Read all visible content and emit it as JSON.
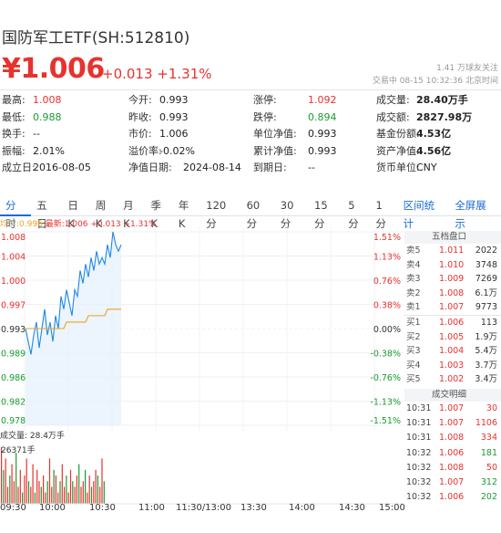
{
  "header": {
    "title": "国防军工ETF(SH:512810)",
    "price": "¥1.006",
    "change": "+0.013 +1.31%",
    "follow": "1.41 万球友关注",
    "status": "交易中 08-15 10:32:36 北京时间"
  },
  "stats": [
    [
      {
        "k": "最高:",
        "v": "1.008",
        "c": "up"
      },
      {
        "k": "今开:",
        "v": "0.993"
      },
      {
        "k": "涨停:",
        "v": "1.092",
        "c": "up"
      },
      {
        "k": "成交量:",
        "v": "28.40万手",
        "c": "b"
      }
    ],
    [
      {
        "k": "最低:",
        "v": "0.988",
        "c": "dn"
      },
      {
        "k": "昨收:",
        "v": "0.993"
      },
      {
        "k": "跌停:",
        "v": "0.894",
        "c": "dn"
      },
      {
        "k": "成交额:",
        "v": "2827.98万",
        "c": "b"
      }
    ],
    [
      {
        "k": "换手:",
        "v": "--"
      },
      {
        "k": "市价:",
        "v": "1.006"
      },
      {
        "k": "单位净值:",
        "v": "0.993"
      },
      {
        "k": "基金份额:",
        "v": "4.53亿",
        "c": "b"
      }
    ],
    [
      {
        "k": "振幅:",
        "v": "2.01%"
      },
      {
        "k": "溢价率:",
        "v": "-0.02%"
      },
      {
        "k": "累计净值:",
        "v": "0.993"
      },
      {
        "k": "资产净值:",
        "v": "4.56亿",
        "c": "b"
      }
    ],
    [
      {
        "k": "成立日:",
        "v": "2016-08-05"
      },
      {
        "k": "净值日期:",
        "v": "2024-08-14"
      },
      {
        "k": "到期日:",
        "v": "--"
      },
      {
        "k": "货币单位:",
        "v": "CNY"
      }
    ]
  ],
  "tabs": [
    "分时",
    "五日",
    "日K",
    "周K",
    "月K",
    "季K",
    "年K",
    "120分",
    "60分",
    "30分",
    "15分",
    "5分",
    "1分"
  ],
  "tabs_right": [
    "区间统计",
    "全屏展示"
  ],
  "legend": {
    "avg": "均价:0.996",
    "cur": "最新:1.006 +0.013 +1.31%"
  },
  "chart_data": {
    "type": "line",
    "series": [
      {
        "name": "最新",
        "values": [
          0.993,
          0.991,
          0.989,
          0.992,
          0.994,
          0.99,
          0.993,
          0.996,
          0.992,
          0.994,
          0.991,
          0.995,
          0.993,
          0.998,
          0.996,
          0.999,
          0.997,
          0.995,
          0.999,
          0.998,
          1.002,
          1.0,
          1.003,
          1.001,
          1.004,
          1.002,
          1.005,
          1.003,
          1.004,
          1.003,
          1.006,
          1.004,
          1.008,
          1.006,
          1.005,
          1.006
        ]
      },
      {
        "name": "均价",
        "values": [
          0.993,
          0.993,
          0.993,
          0.993,
          0.993,
          0.993,
          0.993,
          0.993,
          0.993,
          0.993,
          0.993,
          0.993,
          0.993,
          0.993,
          0.993,
          0.994,
          0.994,
          0.994,
          0.994,
          0.994,
          0.994,
          0.994,
          0.994,
          0.995,
          0.995,
          0.995,
          0.995,
          0.995,
          0.995,
          0.995,
          0.996,
          0.996,
          0.996,
          0.996,
          0.996,
          0.996
        ]
      }
    ],
    "y_left": [
      "1.008",
      "1.004",
      "1.000",
      "0.997",
      "0.993",
      "0.989",
      "0.986",
      "0.982",
      "0.978"
    ],
    "y_right": [
      "1.51%",
      "1.13%",
      "0.76%",
      "0.38%",
      "0.00%",
      "-0.38%",
      "-0.76%",
      "-1.13%",
      "-1.51%"
    ],
    "ylim": [
      0.978,
      1.008
    ],
    "prev_close": 0.993,
    "x_ticks": [
      "09:30",
      "10:00",
      "10:30",
      "11:00",
      "11:30/13:00",
      "13:30",
      "14:00",
      "14:30",
      "15:00"
    ],
    "volume": {
      "label": "成交量: 28.4万手",
      "max_label": "26371手",
      "values": [
        10,
        6,
        8,
        3,
        5,
        7,
        4,
        9,
        3,
        6,
        2,
        5,
        8,
        4,
        3,
        7,
        2,
        6,
        4,
        3,
        5,
        2,
        4,
        8,
        3,
        6,
        5,
        2,
        4,
        7,
        3,
        5,
        2,
        6,
        4,
        3,
        5,
        7,
        3,
        4,
        6,
        2,
        5,
        3,
        4,
        6,
        5,
        3,
        8,
        4
      ]
    }
  },
  "orderbook": {
    "title": "五档盘口",
    "asks": [
      {
        "l": "卖5",
        "p": "1.011",
        "q": "2022"
      },
      {
        "l": "卖4",
        "p": "1.010",
        "q": "3748"
      },
      {
        "l": "卖3",
        "p": "1.009",
        "q": "7269"
      },
      {
        "l": "卖2",
        "p": "1.008",
        "q": "6.1万"
      },
      {
        "l": "卖1",
        "p": "1.007",
        "q": "9773"
      }
    ],
    "bids": [
      {
        "l": "买1",
        "p": "1.006",
        "q": "113"
      },
      {
        "l": "买2",
        "p": "1.005",
        "q": "1.9万"
      },
      {
        "l": "买3",
        "p": "1.004",
        "q": "5.4万"
      },
      {
        "l": "买4",
        "p": "1.003",
        "q": "3.7万"
      },
      {
        "l": "买5",
        "p": "1.002",
        "q": "3.4万"
      }
    ]
  },
  "trades": {
    "title": "成交明细",
    "rows": [
      {
        "t": "10:31",
        "p": "1.007",
        "q": "30",
        "c": "up"
      },
      {
        "t": "10:31",
        "p": "1.007",
        "q": "1106",
        "c": "up"
      },
      {
        "t": "10:31",
        "p": "1.008",
        "q": "334",
        "c": "up"
      },
      {
        "t": "10:32",
        "p": "1.006",
        "q": "181",
        "c": "dn"
      },
      {
        "t": "10:32",
        "p": "1.008",
        "q": "50",
        "c": "up"
      },
      {
        "t": "10:32",
        "p": "1.007",
        "q": "312",
        "c": "dn"
      },
      {
        "t": "10:32",
        "p": "1.006",
        "q": "202",
        "c": "dn"
      }
    ]
  }
}
